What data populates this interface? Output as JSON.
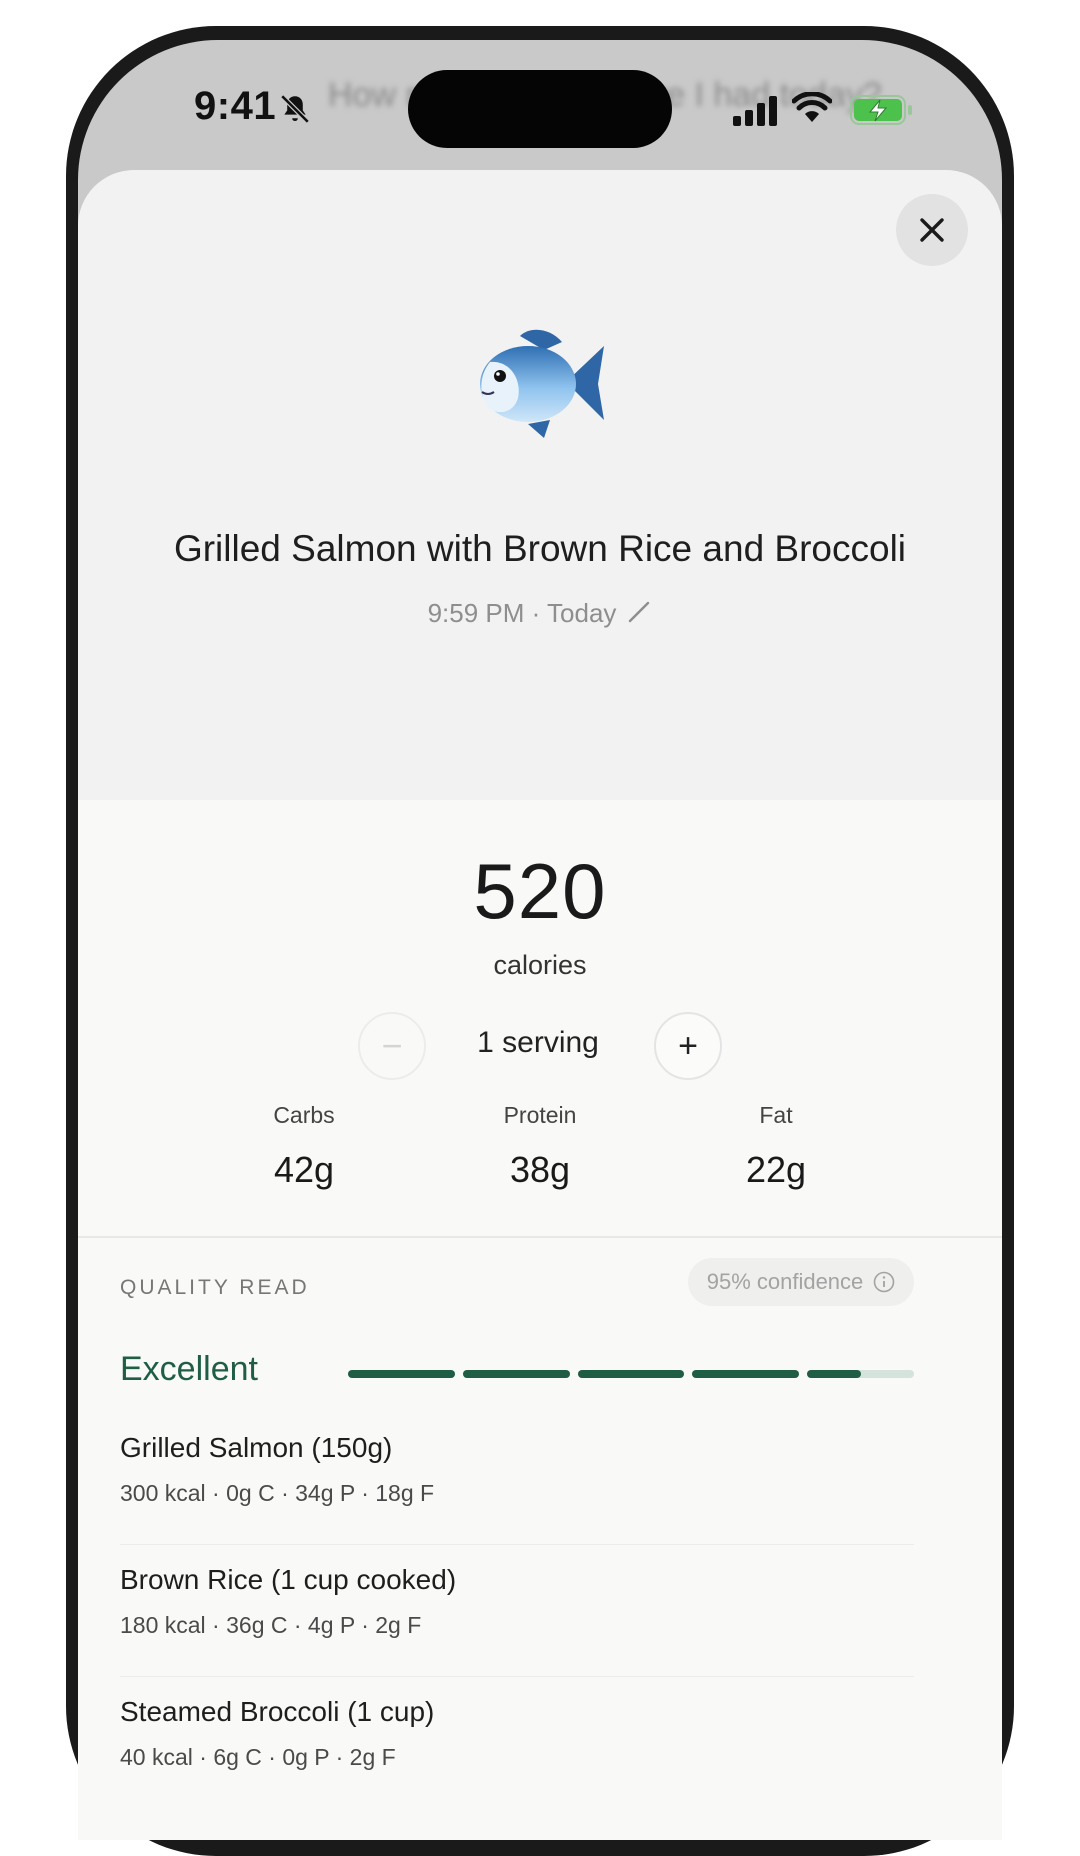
{
  "status_bar": {
    "time": "9:41",
    "background_text": "How much protein have I had today?"
  },
  "meal": {
    "title": "Grilled Salmon with Brown Rice and Broccoli",
    "time_line": "9:59 PM · Today"
  },
  "nutrition": {
    "calories": "520",
    "calories_label": "calories",
    "serving_label": "1 serving",
    "minus": "−",
    "plus": "+",
    "macros": [
      {
        "label": "Carbs",
        "value": "42g"
      },
      {
        "label": "Protein",
        "value": "38g"
      },
      {
        "label": "Fat",
        "value": "22g"
      }
    ]
  },
  "quality": {
    "section_label": "QUALITY READ",
    "confidence": "95% confidence",
    "rating": "Excellent",
    "score_fraction": 0.9,
    "segments": 5,
    "accent_color": "#1f5e45"
  },
  "food_items": [
    {
      "name": "Grilled Salmon (150g)",
      "detail": "300 kcal · 0g C · 34g P · 18g F"
    },
    {
      "name": "Brown Rice (1 cup cooked)",
      "detail": "180 kcal · 36g C · 4g P · 2g F"
    },
    {
      "name": "Steamed Broccoli (1 cup)",
      "detail": "40 kcal · 6g C · 0g P · 2g F"
    }
  ],
  "icons": [
    "bell-slash-icon",
    "signal-icon",
    "wifi-icon",
    "battery-charging-icon",
    "close-icon",
    "fish-icon",
    "pencil-icon",
    "info-icon"
  ]
}
